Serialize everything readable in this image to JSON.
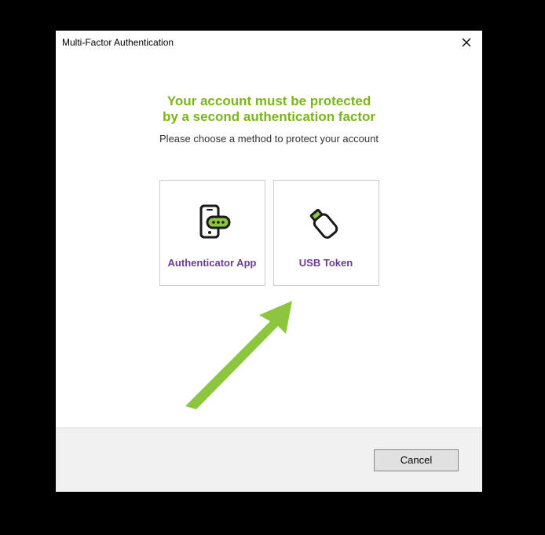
{
  "titlebar": {
    "title": "Multi-Factor Authentication"
  },
  "content": {
    "heading_line1": "Your account must be protected",
    "heading_line2": "by a second authentication factor",
    "subtitle": "Please choose a method to protect your account"
  },
  "options": {
    "authenticator": {
      "label": "Authenticator App"
    },
    "usb": {
      "label": "USB Token"
    }
  },
  "footer": {
    "cancel": "Cancel"
  },
  "colors": {
    "accent_green": "#7cb518",
    "label_purple": "#6b3e91",
    "arrow_green": "#8cc63f"
  }
}
